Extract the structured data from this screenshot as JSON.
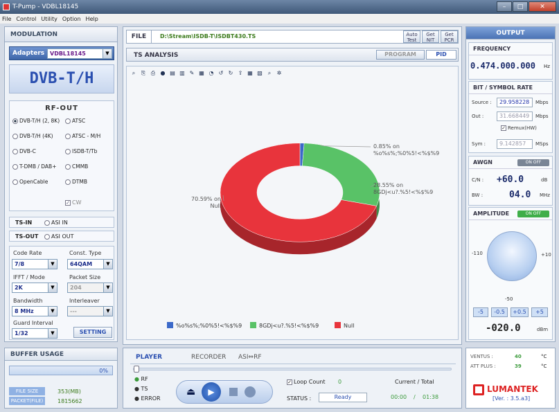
{
  "window": {
    "title": "T-Pump - VDBL18145"
  },
  "menu": [
    "File",
    "Control",
    "Utility",
    "Option",
    "Help"
  ],
  "left": {
    "modulation_title": "MODULATION",
    "adapters_label": "Adapters",
    "adapter_value": "VDBL18145",
    "mode_display": "DVB-T/H",
    "rfout_title": "RF-OUT",
    "rf_options": [
      {
        "label": "DVB-T/H (2, 8K)",
        "selected": true
      },
      {
        "label": "ATSC",
        "selected": false
      },
      {
        "label": "DVB-T/H (4K)",
        "selected": false
      },
      {
        "label": "ATSC - M/H",
        "selected": false
      },
      {
        "label": "DVB-C",
        "selected": false
      },
      {
        "label": "ISDB-T/Tb",
        "selected": false
      },
      {
        "label": "T-DMB / DAB+",
        "selected": false
      },
      {
        "label": "CMMB",
        "selected": false
      },
      {
        "label": "OpenCable",
        "selected": false
      },
      {
        "label": "DTMB",
        "selected": false
      }
    ],
    "cw_label": "CW",
    "tsin_label": "TS-IN",
    "asiin_label": "ASI IN",
    "tsout_label": "TS-OUT",
    "asiout_label": "ASI OUT",
    "code_rate_label": "Code Rate",
    "code_rate": "7/8",
    "const_type_label": "Const. Type",
    "const_type": "64QAM",
    "ifft_label": "IFFT / Mode",
    "ifft": "2K",
    "packet_size_label": "Packet Size",
    "packet_size": "204",
    "bandwidth_label": "Bandwidth",
    "bandwidth": "8 MHz",
    "interleaver_label": "Interleaver",
    "interleaver": "---",
    "guard_label": "Guard Interval",
    "guard": "1/32",
    "setting_label": "SETTING"
  },
  "center": {
    "file_label": "FILE",
    "file_path": "D:\\Stream\\ISDB-T\\ISDBT430.TS",
    "auto_test": [
      "Auto",
      "Test"
    ],
    "get_nit": [
      "Get",
      "NIT"
    ],
    "get_pcr": [
      "Get",
      "PCR"
    ],
    "ts_analysis_title": "TS ANALYSIS",
    "tab_program": "PROGRAM",
    "tab_pid": "PID",
    "toolbar_icons": [
      "zoom-icon",
      "copy-icon",
      "print-icon",
      "color-icon",
      "style-icon",
      "chart-icon",
      "pen-icon",
      "data-icon",
      "pie-icon",
      "rotate-left-icon",
      "rotate-right-icon",
      "export-icon",
      "grid-icon",
      "layout-icon",
      "find-icon",
      "settings-icon"
    ]
  },
  "chart_data": {
    "type": "pie",
    "slices": [
      {
        "name": "Null",
        "value": 70.59,
        "color": "#e8343c",
        "label": "70.59% on\nNull"
      },
      {
        "name": "8GDj<u?.%5!<%$%9",
        "value": 28.55,
        "color": "#59c267",
        "label": "28.55% on\n8GDj<u?.%5!<%$%9"
      },
      {
        "name": "%o%s%;%0%5!<%$%9",
        "value": 0.85,
        "color": "#3b69c9",
        "label": "0.85% on\n%o%s%;%0%5!<%$%9"
      }
    ],
    "legend": [
      "%o%s%;%0%5!<%$%9",
      "8GDj<u?.%5!<%$%9",
      "Null"
    ],
    "legend_position": "bottom"
  },
  "right": {
    "output_title": "OUTPUT",
    "frequency_label": "FREQUENCY",
    "frequency": "0.474.000.000",
    "frequency_unit": "Hz",
    "bitrate_title": "BIT / SYMBOL RATE",
    "source_label": "Source :",
    "source_value": "29.958228",
    "source_unit": "Mbps",
    "out_label": "Out :",
    "out_value": "31.668449",
    "out_unit": "Mbps",
    "remux_label": "Remux(HW)",
    "sym_label": "Sym :",
    "sym_value": "9.142857",
    "sym_unit": "MSps",
    "awgn_title": "AWGN",
    "awgn_switch": "ON OFF",
    "cn_label": "C/N :",
    "cn_value": "+60.0",
    "cn_unit": "dB",
    "bw_label": "BW :",
    "bw_value": "04.0",
    "bw_unit": "MHz",
    "amplitude_title": "AMPLITUDE",
    "amp_switch": "ON OFF",
    "dial_min": "-110",
    "dial_max": "+10",
    "dial_mid": "-50",
    "amp_buttons": [
      "-5",
      "-0.5",
      "+0.5",
      "+5"
    ],
    "amp_value": "-020.0",
    "amp_unit": "dBm"
  },
  "bottom": {
    "buffer_title": "BUFFER USAGE",
    "buffer_percent": "0%",
    "buffer_fraction": 0,
    "file_size_label": "FILE SIZE",
    "file_size": "353(MB)",
    "packet_label": "PACKET(FILE)",
    "packet": "1815662",
    "tabs": [
      "PLAYER",
      "RECORDER",
      "ASI⇔RF"
    ],
    "rf_label": "RF",
    "ts_label": "TS",
    "error_label": "ERROR",
    "loop_label": "Loop Count",
    "loop_value": "0",
    "current_total_label": "Current / Total",
    "current": "00:00",
    "slash": "/",
    "total": "01:38",
    "status_label": "STATUS :",
    "status_value": "Ready",
    "ventus_label": "VENTUS :",
    "ventus_value": "40",
    "ventus_unit": "°C",
    "attplus_label": "ATT PLUS :",
    "attplus_value": "39",
    "attplus_unit": "°C",
    "brand": "LUMANTEK",
    "version": "[Ver. : 3.5.a3]"
  }
}
